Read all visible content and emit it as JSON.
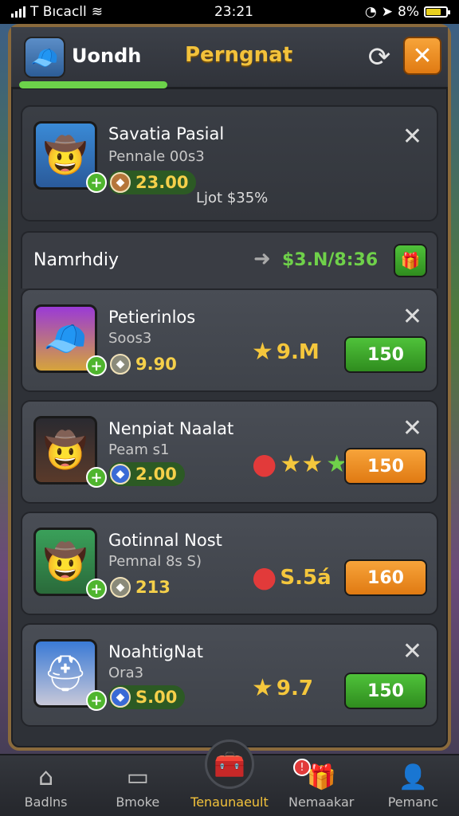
{
  "status_bar": {
    "carrier": "T Bıcacll",
    "time": "23:21",
    "battery": "8%"
  },
  "header": {
    "name": "Uondh",
    "title": "Perngnat"
  },
  "top_card": {
    "name": "Savatia Pasial",
    "sub": "Pennale 00s3",
    "coins": "23.00",
    "extra": "Ljot $35%"
  },
  "section": {
    "title": "Namrhdiy",
    "value": "$3.N/8:36"
  },
  "cards": [
    {
      "name": "Petierinlos",
      "sub": "Soos3",
      "coins": "9.90",
      "value": "9.M",
      "price": "150",
      "price_color": "green"
    },
    {
      "name": "Nenpiat Naalat",
      "sub": "Peam s1",
      "coins": "2.00",
      "value": "",
      "price": "150",
      "price_color": "orange"
    },
    {
      "name": "Gotinnal Nost",
      "sub": "Pemnal 8s S)",
      "coins": "213",
      "value": "S.5á",
      "price": "160",
      "price_color": "orange"
    },
    {
      "name": "NoahtigNat",
      "sub": "Ora3",
      "coins": "S.00",
      "value": "9.7",
      "price": "150",
      "price_color": "green"
    }
  ],
  "bottom_nav": [
    {
      "label": "Badlns",
      "icon": "home-icon"
    },
    {
      "label": "Bmoke",
      "icon": "chat-icon"
    },
    {
      "label": "Tenaunaeult",
      "icon": "chest-icon"
    },
    {
      "label": "Nemaakar",
      "icon": "gift-icon"
    },
    {
      "label": "Pemanc",
      "icon": "profile-icon"
    }
  ]
}
